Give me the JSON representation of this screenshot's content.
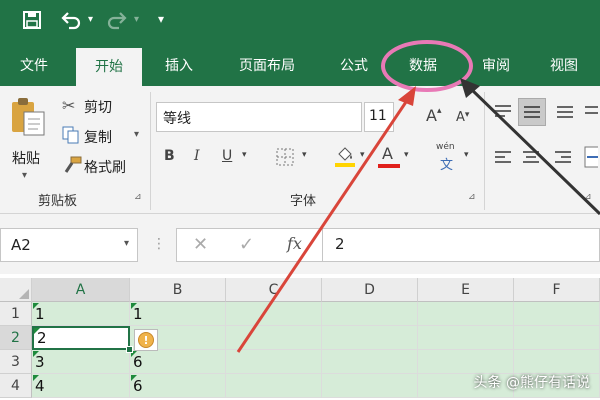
{
  "colors": {
    "brand": "#217346",
    "ribbon_bg": "#f3f3f3",
    "selection": "#d6ecd8",
    "annotation_circle": "#e879b6",
    "arrow_red": "#d9453a",
    "arrow_dark": "#333333"
  },
  "tabs": [
    {
      "label": "文件"
    },
    {
      "label": "开始",
      "active": true
    },
    {
      "label": "插入"
    },
    {
      "label": "页面布局"
    },
    {
      "label": "公式"
    },
    {
      "label": "数据"
    },
    {
      "label": "审阅"
    },
    {
      "label": "视图"
    }
  ],
  "clipboard": {
    "paste_label": "粘贴",
    "cut_label": "剪切",
    "copy_label": "复制",
    "format_painter_label": "格式刷",
    "group_label": "剪贴板"
  },
  "font": {
    "font_name": "等线",
    "font_size": "11",
    "bold": "B",
    "italic": "I",
    "underline": "U",
    "font_color_letter": "A",
    "phonetic_label": "wén",
    "phonetic_char": "文",
    "group_label": "字体"
  },
  "formula_bar": {
    "name_box": "A2",
    "fx_label": "fx",
    "value": "2"
  },
  "grid": {
    "columns": [
      "A",
      "B",
      "C",
      "D",
      "E",
      "F"
    ],
    "rows": [
      {
        "num": "1",
        "a": "1",
        "b": "1"
      },
      {
        "num": "2",
        "a": "2",
        "b": ""
      },
      {
        "num": "3",
        "a": "3",
        "b": "6"
      },
      {
        "num": "4",
        "a": "4",
        "b": "6"
      }
    ]
  },
  "warning_icon_glyph": "!",
  "watermark": "头条 @熊仔有话说"
}
